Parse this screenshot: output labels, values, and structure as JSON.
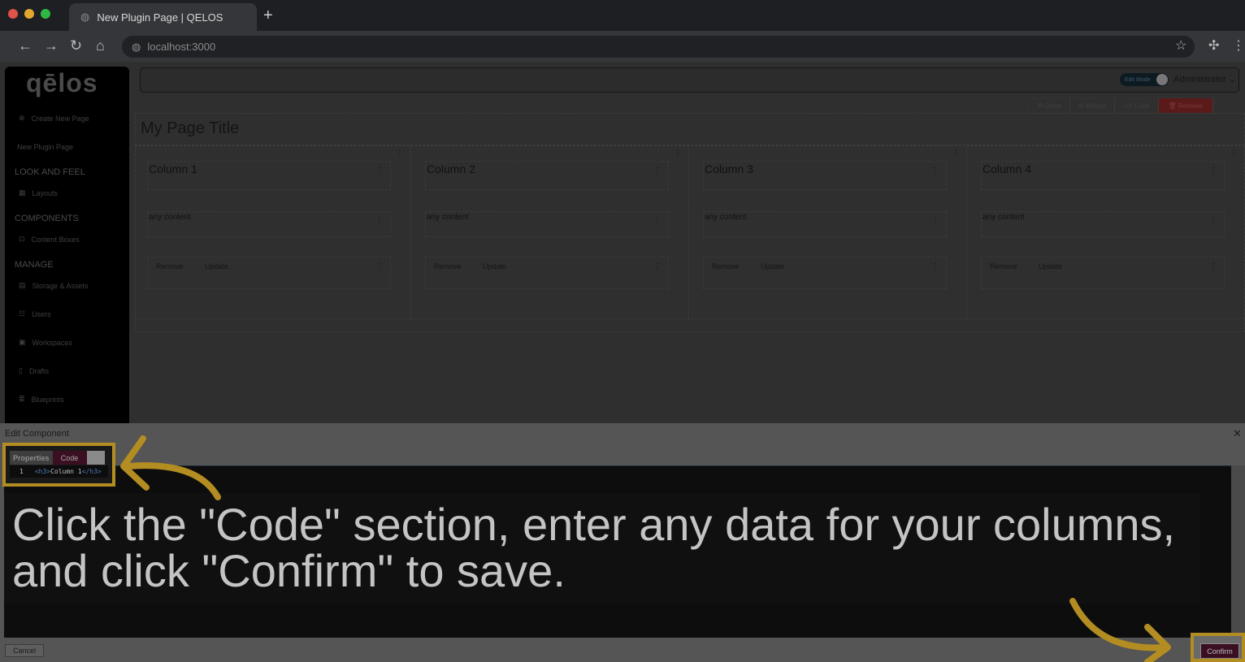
{
  "browser": {
    "tab_title": "New Plugin Page | QELOS",
    "url": "localhost:3000",
    "new_tab": "+",
    "traffic_colors": [
      "#e0524a",
      "#e0a92e",
      "#2fb844"
    ]
  },
  "sidebar": {
    "logo": "qēlos",
    "create": "Create New Page",
    "current": "New Plugin Page",
    "sections": [
      {
        "title": "LOOK AND FEEL",
        "items": [
          {
            "label": "Layouts",
            "icon": "grid-icon"
          }
        ]
      },
      {
        "title": "COMPONENTS",
        "items": [
          {
            "label": "Content Boxes",
            "icon": "box-icon"
          }
        ]
      },
      {
        "title": "MANAGE",
        "items": [
          {
            "label": "Storage & Assets",
            "icon": "storage-icon"
          },
          {
            "label": "Users",
            "icon": "users-icon"
          },
          {
            "label": "Workspaces",
            "icon": "briefcase-icon"
          },
          {
            "label": "Drafts",
            "icon": "file-icon"
          },
          {
            "label": "Blueprints",
            "icon": "database-icon"
          }
        ]
      }
    ]
  },
  "header": {
    "edit_mode": "Edit Mode",
    "user": "Administrator"
  },
  "toolbar": {
    "clone": "Clone",
    "wizard": "Wizard",
    "code": "Code",
    "remove": "Remove"
  },
  "page": {
    "title": "My Page Title",
    "columns": [
      {
        "heading": "Column 1",
        "content": "any content",
        "remove": "Remove",
        "update": "Update"
      },
      {
        "heading": "Column 2",
        "content": "any content",
        "remove": "Remove",
        "update": "Update"
      },
      {
        "heading": "Column 3",
        "content": "any content",
        "remove": "Remove",
        "update": "Update"
      },
      {
        "heading": "Column 4",
        "content": "any content",
        "remove": "Remove",
        "update": "Update"
      }
    ]
  },
  "dialog": {
    "title": "Edit Component",
    "tabs": {
      "properties": "Properties",
      "code": "Code"
    },
    "code": {
      "line": "1",
      "open": "<h3>",
      "text": "Column 1",
      "close": "</h3>"
    },
    "cancel": "Cancel",
    "confirm": "Confirm"
  },
  "tutorial": {
    "caption": "Click the \"Code\" section, enter any data for your columns, and click \"Confirm\" to save.",
    "highlight_color": "#b38d22"
  }
}
